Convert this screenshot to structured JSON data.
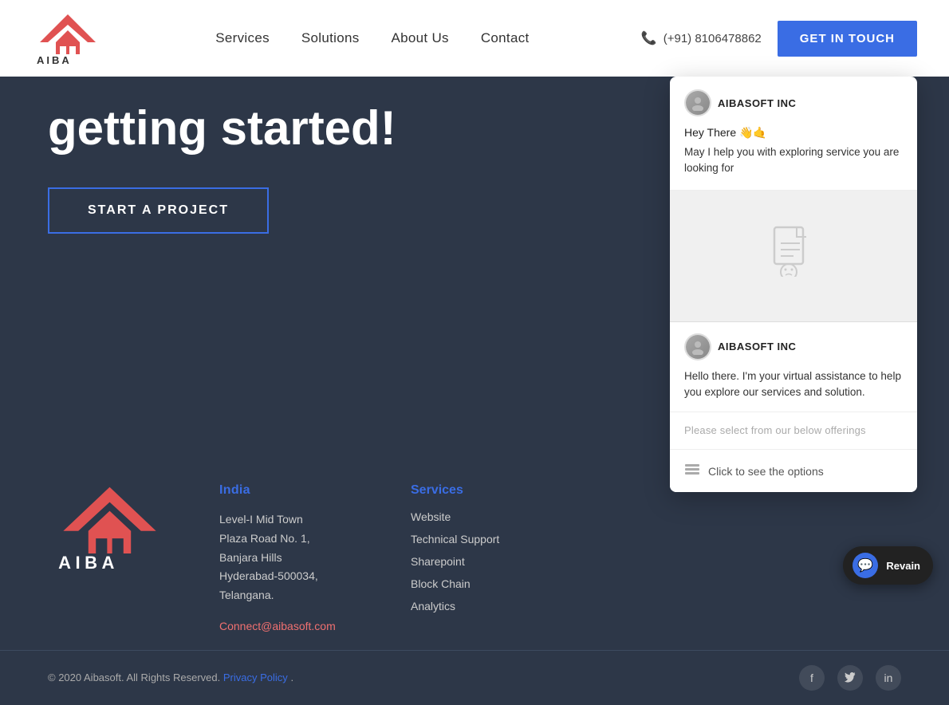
{
  "navbar": {
    "logo_alt": "AIBA Logo",
    "nav_items": [
      {
        "label": "Services",
        "href": "#"
      },
      {
        "label": "Solutions",
        "href": "#"
      },
      {
        "label": "About Us",
        "href": "#"
      },
      {
        "label": "Contact",
        "href": "#"
      }
    ],
    "phone_number": "(+91) 8106478862",
    "cta_label": "GET IN TOUCH"
  },
  "hero": {
    "title_line1": "getting started!"
  },
  "start_project": {
    "label": "START A PROJECT"
  },
  "footer": {
    "india_label": "India",
    "address_line1": "Level-I Mid Town",
    "address_line2": "Plaza Road No. 1,",
    "address_line3": "Banjara Hills",
    "address_line4": "Hyderabad-500034,",
    "address_line5": "Telangana.",
    "email": "Connect@aibasoft.com",
    "services_label": "Services",
    "service_items": [
      {
        "label": "Website"
      },
      {
        "label": "Technical Support"
      },
      {
        "label": "Sharepoint"
      },
      {
        "label": "Block Chain"
      },
      {
        "label": "Analytics"
      }
    ]
  },
  "footer_bottom": {
    "copyright": "© 2020 Aibasoft. All Rights Reserved.",
    "privacy_label": "Privacy Policy",
    "privacy_suffix": "."
  },
  "chat": {
    "sender_name": "AIBASOFT INC",
    "greeting": "Hey There 👋🤙",
    "message1": "May I help you with exploring service you are looking for",
    "sender_name2": "AIBASOFT INC",
    "message2": "Hello there. I'm your virtual assistance to help you explore our services and solution.",
    "offerings_text": "Please select from our below offerings",
    "cta_text": "Click to see the options"
  },
  "revain": {
    "label": "Revain"
  },
  "social": {
    "icons": [
      "f",
      "t",
      "in"
    ]
  }
}
